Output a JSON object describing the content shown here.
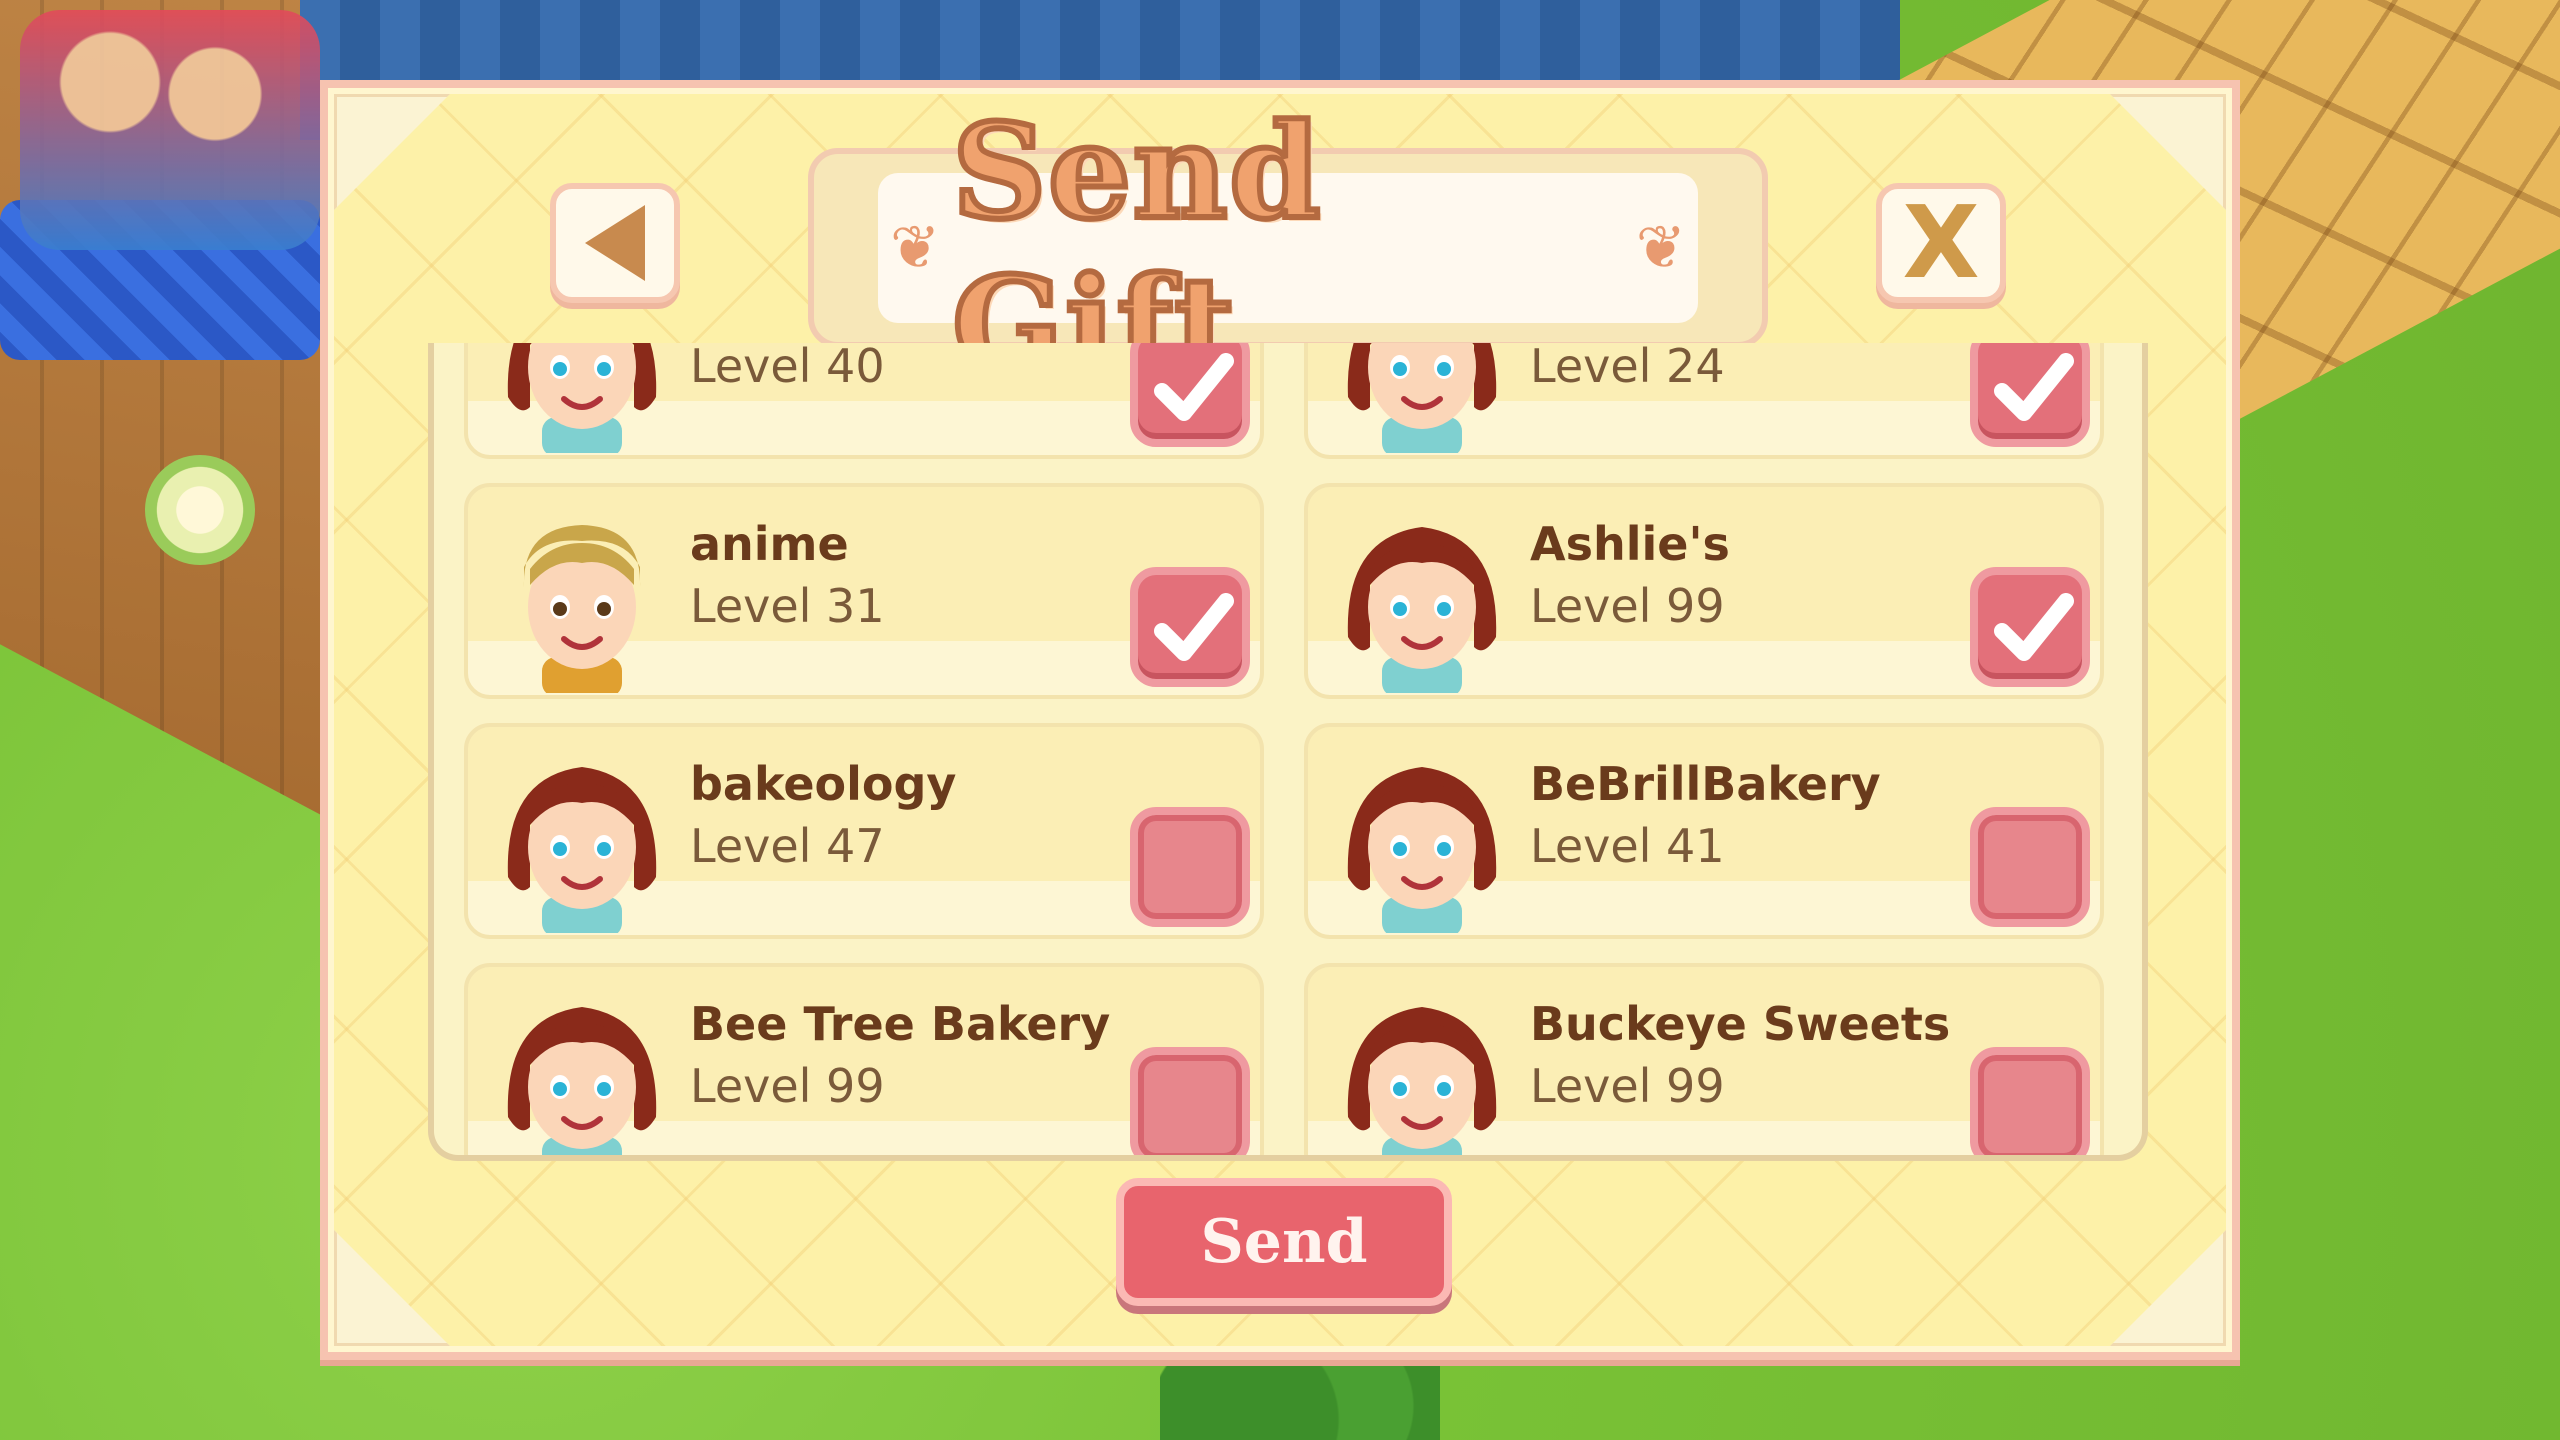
{
  "dialog": {
    "title": "Send Gift",
    "back_icon": "back-arrow-icon",
    "close_label": "X",
    "send_label": "Send"
  },
  "friends": [
    {
      "name": "",
      "level": "Level 40",
      "selected": true,
      "avatar": "girl"
    },
    {
      "name": "",
      "level": "Level 24",
      "selected": true,
      "avatar": "girl"
    },
    {
      "name": "anime",
      "level": "Level 31",
      "selected": true,
      "avatar": "boy"
    },
    {
      "name": "Ashlie's",
      "level": "Level 99",
      "selected": true,
      "avatar": "girl"
    },
    {
      "name": "bakeology",
      "level": "Level 47",
      "selected": false,
      "avatar": "girl"
    },
    {
      "name": "BeBrillBakery",
      "level": "Level 41",
      "selected": false,
      "avatar": "girl"
    },
    {
      "name": "Bee Tree Bakery",
      "level": "Level 99",
      "selected": false,
      "avatar": "girl"
    },
    {
      "name": "Buckeye Sweets",
      "level": "Level 99",
      "selected": false,
      "avatar": "girl"
    }
  ],
  "colors": {
    "checkbox_fill": "#e3707a",
    "send_button": "#e8646d",
    "panel_bg": "#fdf1a8"
  }
}
